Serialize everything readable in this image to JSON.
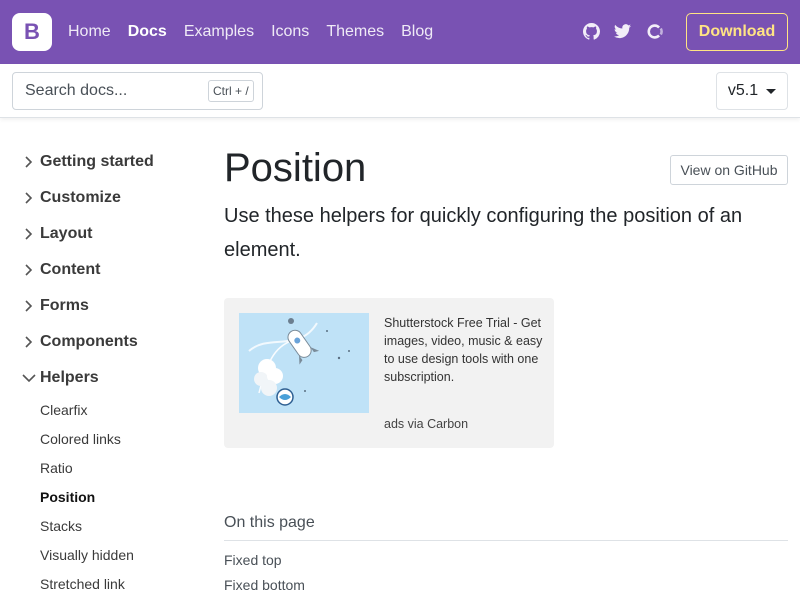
{
  "navbar": {
    "brand_letter": "B",
    "links": [
      {
        "label": "Home",
        "active": false
      },
      {
        "label": "Docs",
        "active": true
      },
      {
        "label": "Examples",
        "active": false
      },
      {
        "label": "Icons",
        "active": false
      },
      {
        "label": "Themes",
        "active": false
      },
      {
        "label": "Blog",
        "active": false
      }
    ],
    "icons": [
      "github-icon",
      "twitter-icon",
      "opencollective-icon"
    ],
    "download_label": "Download",
    "colors": {
      "background": "#7952b3",
      "download_accent": "#ffe484"
    }
  },
  "subnav": {
    "search_placeholder": "Search docs...",
    "search_shortcut": "Ctrl + /",
    "version": "v5.1"
  },
  "sidebar": {
    "groups": [
      {
        "label": "Getting started",
        "expanded": false
      },
      {
        "label": "Customize",
        "expanded": false
      },
      {
        "label": "Layout",
        "expanded": false
      },
      {
        "label": "Content",
        "expanded": false
      },
      {
        "label": "Forms",
        "expanded": false
      },
      {
        "label": "Components",
        "expanded": false
      },
      {
        "label": "Helpers",
        "expanded": true
      }
    ],
    "items": [
      {
        "label": "Clearfix",
        "active": false
      },
      {
        "label": "Colored links",
        "active": false
      },
      {
        "label": "Ratio",
        "active": false
      },
      {
        "label": "Position",
        "active": true
      },
      {
        "label": "Stacks",
        "active": false
      },
      {
        "label": "Visually hidden",
        "active": false
      },
      {
        "label": "Stretched link",
        "active": false
      }
    ]
  },
  "main": {
    "title": "Position",
    "github_button": "View on GitHub",
    "lead": "Use these helpers for quickly configuring the position of an element.",
    "ad": {
      "text": "Shutterstock Free Trial - Get images, video, music & easy to use design tools with one subscription.",
      "via": "ads via Carbon"
    },
    "toc": {
      "title": "On this page",
      "links": [
        "Fixed top",
        "Fixed bottom"
      ]
    }
  }
}
